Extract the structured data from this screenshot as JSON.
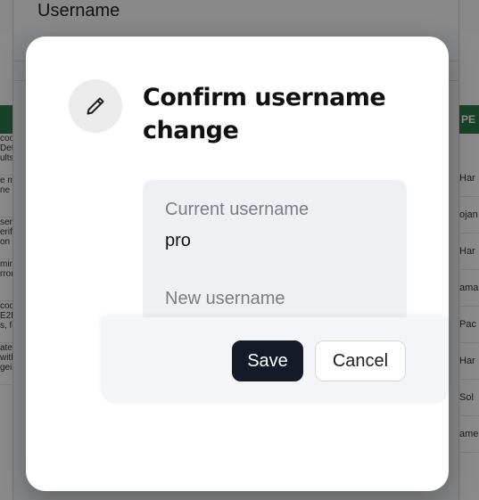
{
  "background": {
    "username_label": "Username",
    "right_header": "PE",
    "left_cells": [
      "coo\nDete\nults.",
      "e m\nne n",
      "ser\nerif\non (",
      "min\nrron",
      "coo\nE2E\ns, fo",
      "ate\nwith\ngei"
    ],
    "right_cells": [
      "Har",
      "ojan",
      "Har",
      "ama",
      "Pac",
      "Har",
      "Sol",
      "ame"
    ]
  },
  "modal": {
    "title": "Confirm username change",
    "icon": "pencil-icon",
    "current_label": "Current username",
    "current_value": "pro",
    "new_label": "New username",
    "save_label": "Save",
    "cancel_label": "Cancel"
  },
  "colors": {
    "overlay": "#000000",
    "save_button_bg": "#151a28",
    "fields_bg": "#eff0f3",
    "header_green": "#2f7a4c"
  }
}
